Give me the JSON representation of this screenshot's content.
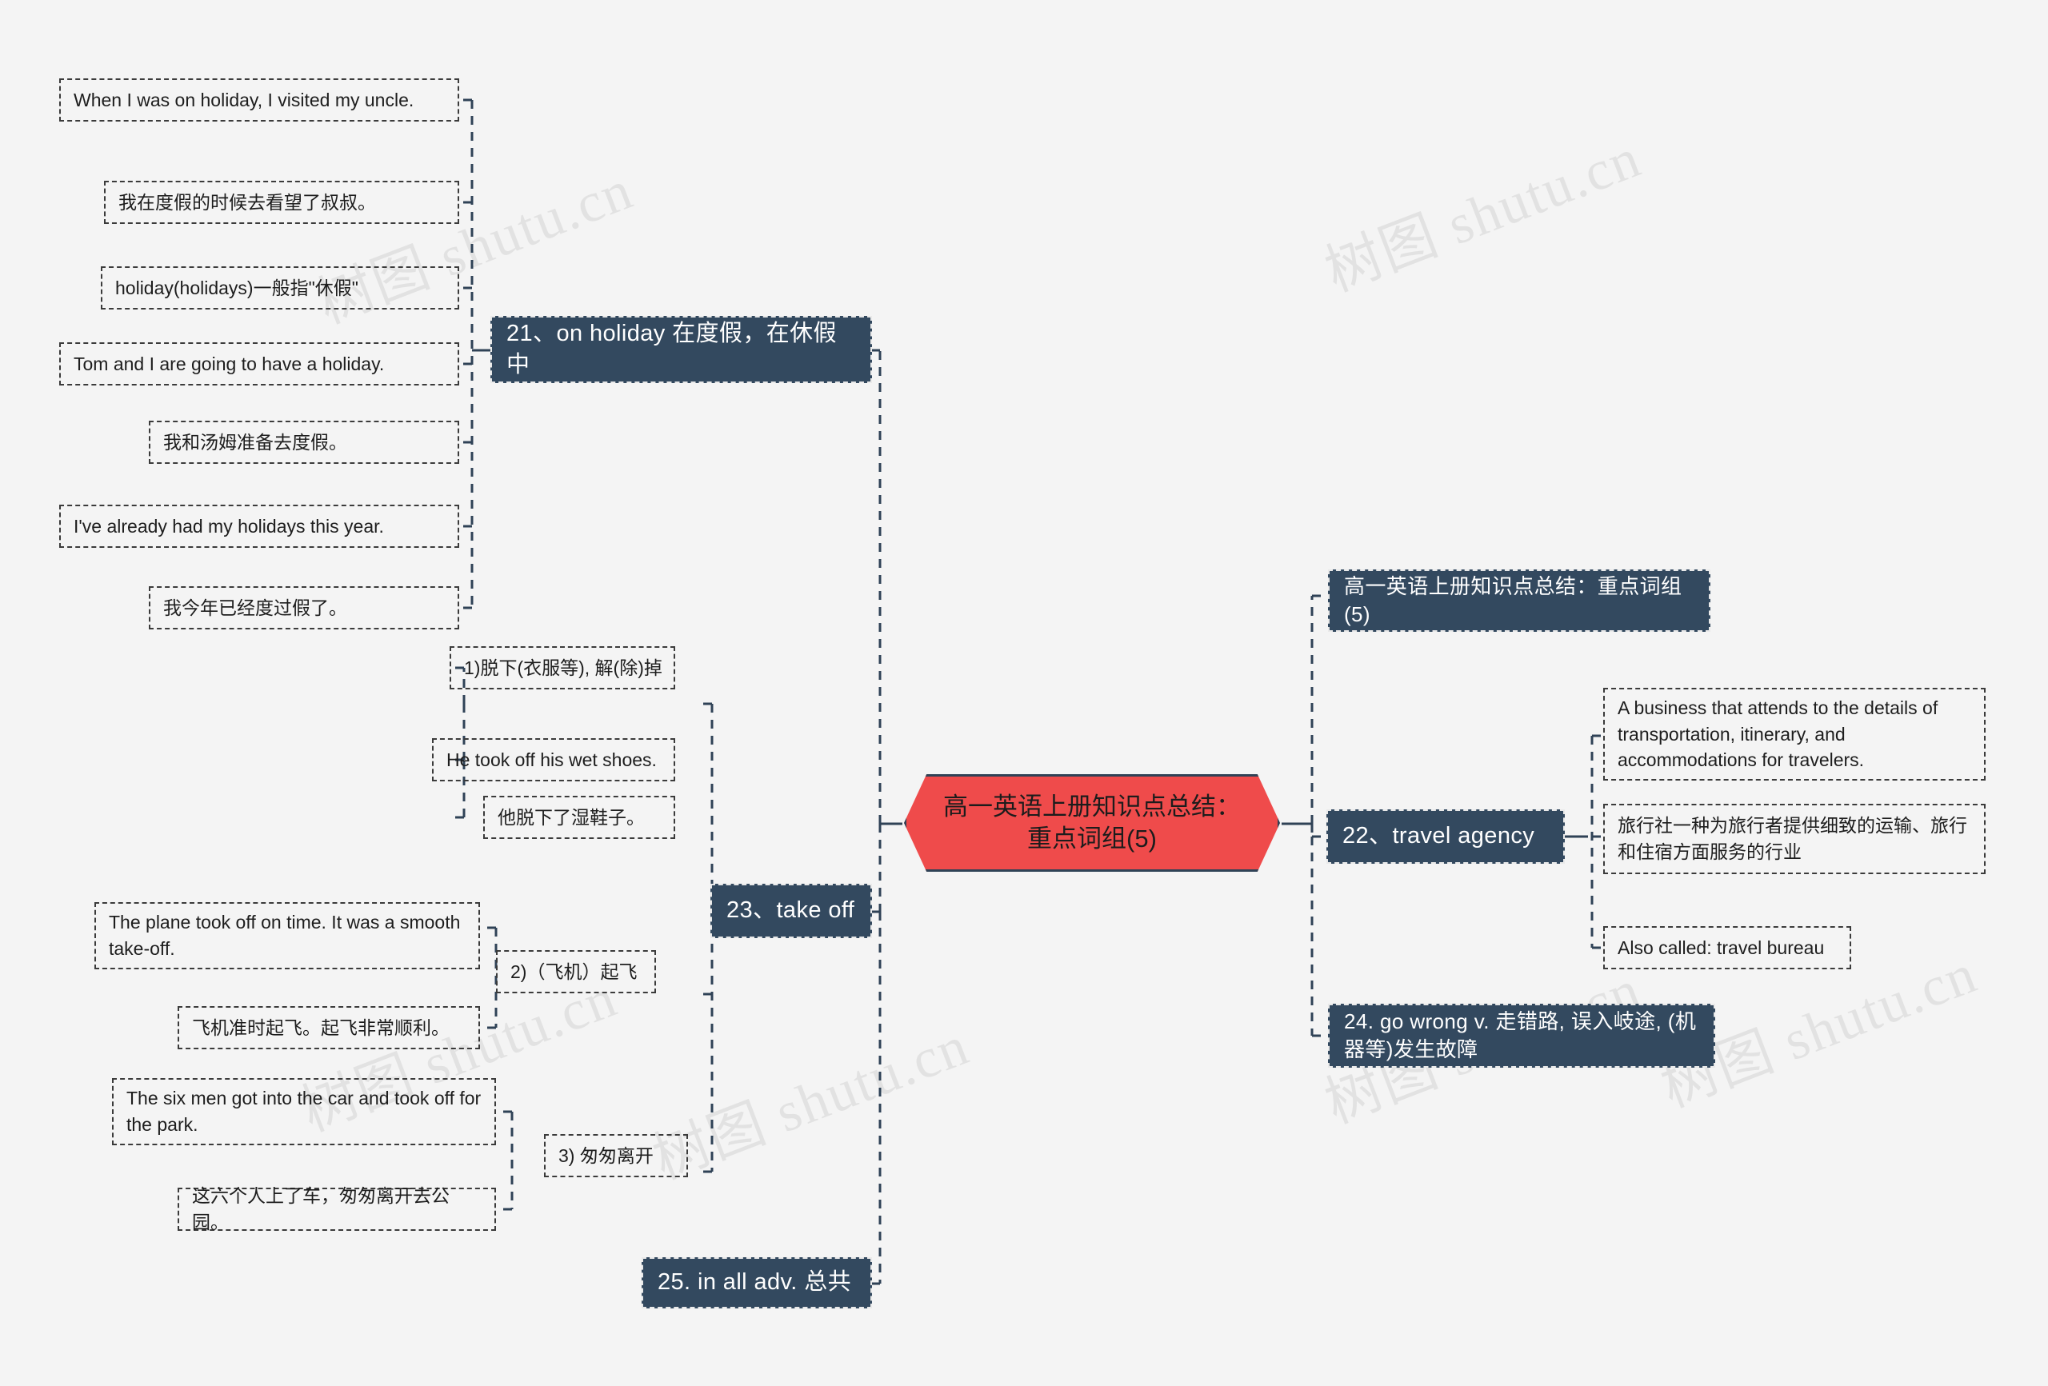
{
  "root": {
    "label": "高一英语上册知识点总结：重点词组(5)"
  },
  "watermarks": [
    {
      "text": "树图 shutu.cn"
    },
    {
      "text": "树图 shutu.cn"
    },
    {
      "text": "树图 shutu.cn"
    },
    {
      "text": "树图 shutu.cn"
    },
    {
      "text": "树图 shutu.cn"
    },
    {
      "text": "树图 shutu.cn"
    }
  ],
  "branches": {
    "on_holiday": {
      "label": "21、on holiday 在度假，在休假中",
      "children": [
        {
          "label": "When I was on holiday, I visited my uncle."
        },
        {
          "label": "我在度假的时候去看望了叔叔。"
        },
        {
          "label": "holiday(holidays)一般指\"休假\""
        },
        {
          "label": "Tom and I are going to have a holiday."
        },
        {
          "label": "我和汤姆准备去度假。"
        },
        {
          "label": "I've already had my holidays this year."
        },
        {
          "label": "我今年已经度过假了。"
        }
      ]
    },
    "travel_agency": {
      "label": "22、travel agency",
      "children": [
        {
          "label": "A business that attends to the details of transportation, itinerary, and accommodations for travelers."
        },
        {
          "label": "旅行社一种为旅行者提供细致的运输、旅行和住宿方面服务的行业"
        },
        {
          "label": "Also called: travel bureau"
        }
      ]
    },
    "take_off": {
      "label": "23、take off",
      "children": [
        {
          "label": "1)脱下(衣服等), 解(除)掉"
        },
        {
          "label": "He took off his wet shoes."
        },
        {
          "label": "他脱下了湿鞋子。"
        },
        {
          "label": "2)（飞机）起飞"
        },
        {
          "label": "The plane took off on time. It was a smooth take-off."
        },
        {
          "label": "飞机准时起飞。起飞非常顺利。"
        },
        {
          "label": "3) 匆匆离开"
        },
        {
          "label": "The six men got into the car and took off for the park."
        },
        {
          "label": "这六个人上了车，匆匆离开去公园。"
        }
      ]
    },
    "summary_right": {
      "label": "高一英语上册知识点总结：重点词组(5)"
    },
    "go_wrong": {
      "label": "24. go wrong  v. 走错路, 误入岐途, (机器等)发生故障"
    },
    "in_all": {
      "label": "25. in all  adv. 总共"
    }
  },
  "colors": {
    "topic_bg": "#33495f",
    "root_bg": "#ef4b4b",
    "root_border": "#2f4256",
    "canvas_bg": "#f4f4f4",
    "leaf_border": "#3b3b3b"
  }
}
